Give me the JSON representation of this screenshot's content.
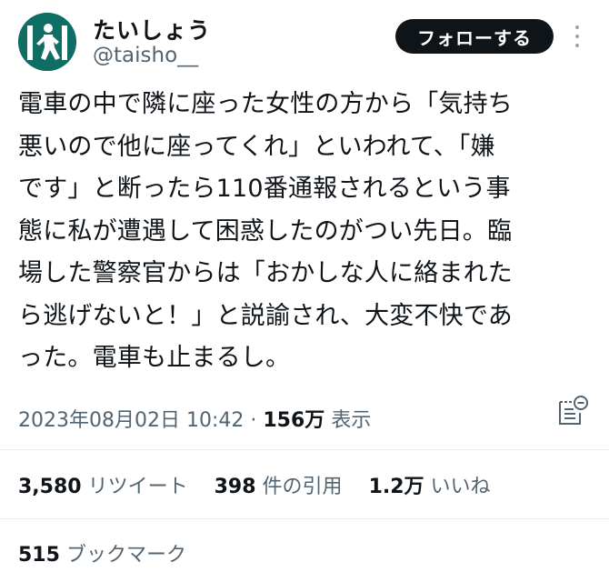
{
  "user": {
    "display_name": "たいしょう",
    "handle": "@taisho__"
  },
  "follow_button": "フォローする",
  "tweet": {
    "text": "電車の中で隣に座った女性の方から「気持ち\n悪いので他に座ってくれ」といわれて、「嫌\nです」と断ったら110番通報されるという事\n態に私が遭遇して困惑したのがつい先日。臨\n場した警察官からは「おかしな人に絡まれた\nら逃げないと！」と説諭され、大変不快であ\nった。電車も止まるし。"
  },
  "meta": {
    "timestamp": "2023年08月02日 10:42",
    "separator": "·",
    "views_count": "156万",
    "views_label": "表示"
  },
  "stats": {
    "retweets_count": "3,580",
    "retweets_label": "リツイート",
    "quotes_count": "398",
    "quotes_label": "件の引用",
    "likes_count": "1.2万",
    "likes_label": "いいね",
    "bookmarks_count": "515",
    "bookmarks_label": "ブックマーク"
  },
  "icons": {
    "more": "more-dots-icon",
    "bookmark": "document-bookmark-icon"
  },
  "colors": {
    "avatar_bg": "#0f6e63",
    "follow_bg": "#0f1419",
    "secondary_text": "#536471"
  }
}
